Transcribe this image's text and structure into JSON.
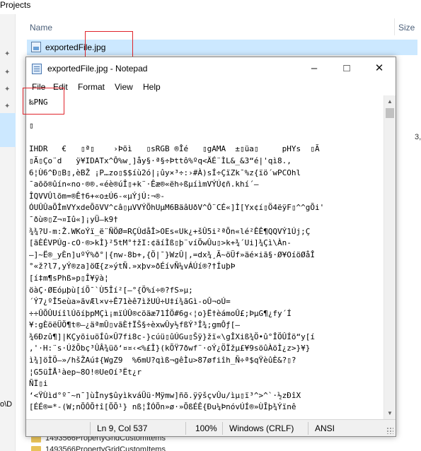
{
  "explorer": {
    "breadcrumb": "Projects",
    "column_name": "Name",
    "column_size": "Size",
    "selected_file": "exportedFile.jpg",
    "size_partial": "3,",
    "path_partial": "o\\D",
    "bottom_items": [
      "1493566PropertyGridCustomItems",
      "1493566PropertyGridCustomItems"
    ]
  },
  "notepad": {
    "title": "exportedFile.jpg - Notepad",
    "menu": [
      "File",
      "Edit",
      "Format",
      "View",
      "Help"
    ],
    "content": "‰PNG\n\n▯\n\nIHDR   €   ▯ª▯    ›Þõì   ▯sRGB ®Î­é   ▯gAMA  ±▯üa▯     pHYs  ▯Ã\n▯Ã▯Ço¨d   ÿ¥IDATx^Ô%w¸]åy§·ª§÷Þttô%ºq<ÄÉ¨ÌL&_&3“é|'qì8.,\n6¦Ù6^Ð▯B▯,èBŽ ¡P…zo▯$$íù2ó|¡ûy×³÷:›#À)sÍ÷ÇïZk¯%z{ïö´wPCOhl\n¯aõõ®ûín«no·®®.«éè®úÎ▯+k¨·Êæ®«ëh÷ßµíìmVÝÚ¢ñ.khí´–\nÎQVVÛlõm=®Ê†6+«o±Ú6-«µÝjÚ:¬®-\nÓUÛÛaÕÎmVYxdeÕõVV^câ▯µVVÝÕhUµM6BäâUðV^Ô¨CÉ«]Ì[Yx¢í▯Ö4ëÿF▯^^gÕi'\n¯ðù®▯Z¬¤Iû«]¡yÜ–k9†\n¾¾?U-m:Ž.WKoÝï_ë¨ÑÖØ=RÇÙdåÎ>OEs«Uk¿+šÛ5i²ªÕn«lé²ÊÊ¶QQVÝ1Új;Ç\n[ãÈÉVPÚg-cO·®>kÌ}²5tM°†žI:¢ãíÌß▯þ¨víÖwÛu▯>k+¾´Ui]¾Çì\\Àn-\n—]~Ë®_yÈn]uºÝ%ð°|{nw-8b+,{Ö|¯}WzÛ|,=dx¾¸Ã~öÜf»äé×iã§·Ø¥OíöØåÎ\n°«ž?l7,yÝ®za]öŒ{z»ýtÑ.»xþv»ðÉívÑ¼vÁÚí®?†ÍuþÞ\n[í‡m¶sPhß»p▯Î¥ÿà¦\nöàÇ·ØEóµþù[íÕ¯`Ù5Îí²[–°{Ö%í÷®?fS»µ;\n´Ý7¿ºÎ5eùa»ãvÆl×v÷Ê71èê7ìžUÚ÷U‡í¾ãGì-oÛ¬oÚ=\n÷÷ÛÕÛUíîlÚõíþpMÇì¡mïÚÛ®cöäæ71ÍÖ#6g‹¦o}Ë†èámoÛ£;ÞµG¶¿fy´Í\n¥:gÈöëÜÖ¶t®–¿äªmÛ▯vãÈ†ÏŠ§÷èxwÛy½fßÝ³Î¾;gmÔƒ[–\n¾6Ðzû¶]|KÇyõiuöÍû×Û7fi8c-}cúü▯ûÚGu▯Šÿ}žï«\\gÎXiß¾Ö•û°ÎÖÛÍö“y[í\n,'·H:¨s·ÚžÕbç³ÛÂ¾üõ‘¤¤‹<%£Î}(kÕŸ7ðwf¨·oÝ¿ÖÏžµ£¥9söûÀöÌ¿z>}¥}\nì¾]öÌÖ–»/hšŽAú‡{WgZ9  %6mU?qìß¬gêÌu>87øfiîh_Ñ÷ª$qŸèûÈ&?▯?\n¦G5üÌÅ¹àep~8O!®UeOí³Ët¿r\nÑÏ▯i\n‘<ŸÙìd°º¯~n¯]ùÌny$ûyìkváÜü·Mÿmw]ñõ.ÿÿšçvÛu/ìµ▯ï³^>^`·½zÐîX\n[ÉÉ®=*-(W;nÕÔÕ†î[ÕÕ¹} nß¦ÎÓÕn»ø·»ÕßÉÊ{Ðu¼ÞnóvÚÍ®»ÙĨþ¾Ýïnê"
  },
  "status": {
    "position": "Ln 9, Col 537",
    "zoom": "100%",
    "line_endings": "Windows (CRLF)",
    "encoding": "ANSI"
  }
}
